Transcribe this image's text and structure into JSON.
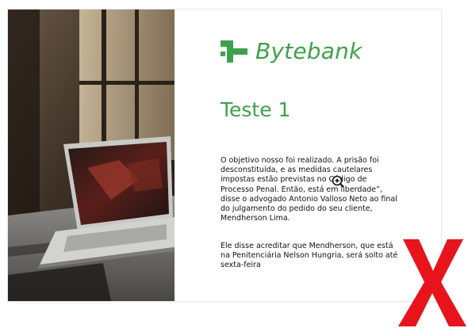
{
  "card": {
    "brand": {
      "name": "Bytebank",
      "logo_icon": "bytebank-logo-icon",
      "color": "#3fa14b"
    },
    "title": "Teste 1",
    "paragraphs": [
      "O objetivo nosso foi realizado. A prisão foi desconstituída, e as medidas cautelares impostas estão previstas no Código de Processo Penal. Então, está em liberdade”, disse o advogado Antonio Valloso Neto ao final do julgamento do pedido do seu cliente, Mendherson Lima.",
      "Ele disse acreditar que Mendherson, que está na Penitenciária Nelson Hungria, será solto até sexta-feira"
    ],
    "photo_icon": "laptop-photo"
  },
  "overlays": {
    "cursor_icon": "zoom-in-cursor-icon",
    "mark_icon": "red-x-mark-icon",
    "mark_color": "#e8141c"
  }
}
